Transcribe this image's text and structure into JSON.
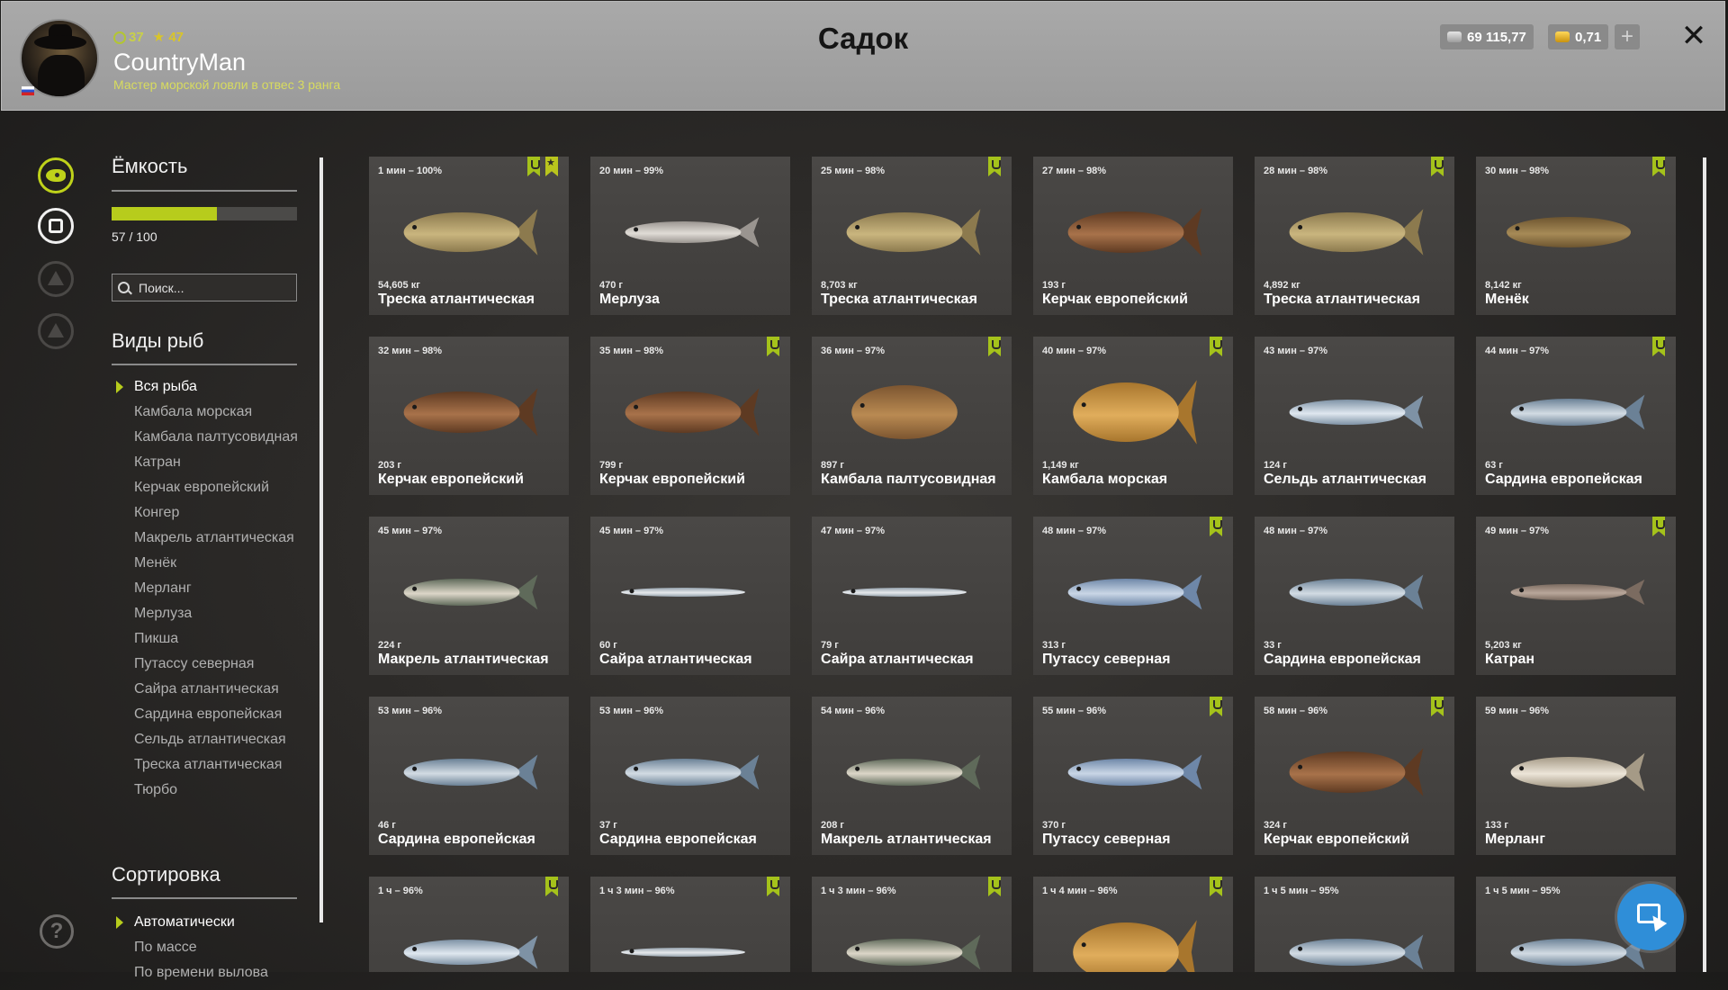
{
  "header": {
    "title": "Садок",
    "player": {
      "level": "37",
      "rank_level": "47",
      "name": "CountryMan",
      "rank_title": "Мастер морской ловли в отвес 3 ранга"
    },
    "currency": {
      "silver": "69 115,77",
      "gold": "0,71"
    },
    "plus_label": "+",
    "close_label": "✕"
  },
  "capacity": {
    "title": "Ёмкость",
    "text": "57 / 100",
    "fraction": 0.57
  },
  "search": {
    "placeholder": "Поиск..."
  },
  "species": {
    "title": "Виды рыб",
    "items": [
      "Вся рыба",
      "Камбала морская",
      "Камбала палтусовидная",
      "Катран",
      "Керчак европейский",
      "Конгер",
      "Макрель атлантическая",
      "Менёк",
      "Мерланг",
      "Мерлуза",
      "Пикша",
      "Путассу северная",
      "Сайра атлантическая",
      "Сардина европейская",
      "Сельдь атлантическая",
      "Треска атлантическая",
      "Тюрбо"
    ],
    "active_index": 0
  },
  "sorting": {
    "title": "Сортировка",
    "items": [
      "Автоматически",
      "По массе",
      "По времени вылова"
    ],
    "active_index": 0
  },
  "help_label": "?",
  "colors": {
    "accent": "#b7cc1c",
    "card_bg": "#474543",
    "fab": "#2f8ed8"
  },
  "fish": [
    {
      "time": "1 мин – 100%",
      "weight": "54,605 кг",
      "name": "Треска атлантическая",
      "kind": "cod",
      "tag": "star"
    },
    {
      "time": "20 мин – 99%",
      "weight": "470 г",
      "name": "Мерлуза",
      "kind": "hake",
      "tag": ""
    },
    {
      "time": "25 мин – 98%",
      "weight": "8,703 кг",
      "name": "Треска атлантическая",
      "kind": "cod",
      "tag": "hook"
    },
    {
      "time": "27 мин – 98%",
      "weight": "193 г",
      "name": "Керчак европейский",
      "kind": "sculpin",
      "tag": ""
    },
    {
      "time": "28 мин – 98%",
      "weight": "4,892 кг",
      "name": "Треска атлантическая",
      "kind": "cod",
      "tag": "hook"
    },
    {
      "time": "30 мин – 98%",
      "weight": "8,142 кг",
      "name": "Менёк",
      "kind": "tusk",
      "tag": "hook"
    },
    {
      "time": "32 мин – 98%",
      "weight": "203 г",
      "name": "Керчак европейский",
      "kind": "sculpin",
      "tag": ""
    },
    {
      "time": "35 мин – 98%",
      "weight": "799 г",
      "name": "Керчак европейский",
      "kind": "sculpin",
      "tag": "hook"
    },
    {
      "time": "36 мин – 97%",
      "weight": "897 г",
      "name": "Камбала палтусовидная",
      "kind": "dab",
      "tag": "hook"
    },
    {
      "time": "40 мин – 97%",
      "weight": "1,149 кг",
      "name": "Камбала морская",
      "kind": "plaice",
      "tag": "hook"
    },
    {
      "time": "43 мин – 97%",
      "weight": "124 г",
      "name": "Сельдь атлантическая",
      "kind": "herring",
      "tag": ""
    },
    {
      "time": "44 мин – 97%",
      "weight": "63 г",
      "name": "Сардина европейская",
      "kind": "sardine",
      "tag": "hook"
    },
    {
      "time": "45 мин – 97%",
      "weight": "224 г",
      "name": "Макрель атлантическая",
      "kind": "mackerel",
      "tag": ""
    },
    {
      "time": "45 мин – 97%",
      "weight": "60 г",
      "name": "Сайра атлантическая",
      "kind": "saury",
      "tag": ""
    },
    {
      "time": "47 мин – 97%",
      "weight": "79 г",
      "name": "Сайра атлантическая",
      "kind": "saury",
      "tag": ""
    },
    {
      "time": "48 мин – 97%",
      "weight": "313 г",
      "name": "Путассу северная",
      "kind": "whiting",
      "tag": "hook"
    },
    {
      "time": "48 мин – 97%",
      "weight": "33 г",
      "name": "Сардина европейская",
      "kind": "sardine",
      "tag": ""
    },
    {
      "time": "49 мин – 97%",
      "weight": "5,203 кг",
      "name": "Катран",
      "kind": "dogfish",
      "tag": "hook"
    },
    {
      "time": "53 мин – 96%",
      "weight": "46 г",
      "name": "Сардина европейская",
      "kind": "sardine",
      "tag": ""
    },
    {
      "time": "53 мин – 96%",
      "weight": "37 г",
      "name": "Сардина европейская",
      "kind": "sardine",
      "tag": ""
    },
    {
      "time": "54 мин – 96%",
      "weight": "208 г",
      "name": "Макрель атлантическая",
      "kind": "mackerel",
      "tag": ""
    },
    {
      "time": "55 мин – 96%",
      "weight": "370 г",
      "name": "Путассу северная",
      "kind": "whiting",
      "tag": "hook"
    },
    {
      "time": "58 мин – 96%",
      "weight": "324 г",
      "name": "Керчак европейский",
      "kind": "sculpin",
      "tag": "hook"
    },
    {
      "time": "59 мин – 96%",
      "weight": "133 г",
      "name": "Мерланг",
      "kind": "merlang",
      "tag": ""
    },
    {
      "time": "1 ч – 96%",
      "weight": "",
      "name": "",
      "kind": "herring",
      "tag": "hook"
    },
    {
      "time": "1 ч 3 мин – 96%",
      "weight": "",
      "name": "",
      "kind": "saury",
      "tag": "hook"
    },
    {
      "time": "1 ч 3 мин – 96%",
      "weight": "",
      "name": "",
      "kind": "mackerel",
      "tag": "hook"
    },
    {
      "time": "1 ч 4 мин – 96%",
      "weight": "",
      "name": "",
      "kind": "plaice",
      "tag": "hook"
    },
    {
      "time": "1 ч 5 мин – 95%",
      "weight": "",
      "name": "",
      "kind": "sardine",
      "tag": ""
    },
    {
      "time": "1 ч 5 мин – 95%",
      "weight": "",
      "name": "",
      "kind": "sardine",
      "tag": ""
    }
  ]
}
